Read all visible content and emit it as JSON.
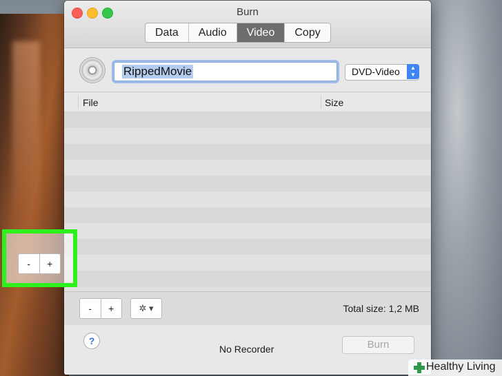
{
  "window": {
    "title": "Burn"
  },
  "tabs": [
    {
      "label": "Data",
      "active": false
    },
    {
      "label": "Audio",
      "active": false
    },
    {
      "label": "Video",
      "active": true
    },
    {
      "label": "Copy",
      "active": false
    }
  ],
  "name_field": {
    "value": "RippedMovie"
  },
  "format_select": {
    "selected": "DVD-Video",
    "icon": "up-down-chevron-icon"
  },
  "table": {
    "columns": [
      "File",
      "Size"
    ],
    "rows": []
  },
  "toolbar": {
    "remove_label": "-",
    "add_label": "+",
    "gear_label": "✲ ▾",
    "total_size": "Total size: 1,2 MB"
  },
  "footer": {
    "help_label": "?",
    "recorder_status": "No Recorder",
    "burn_label": "Burn"
  },
  "watermark": {
    "text": "Healthy Living"
  },
  "colors": {
    "highlight": "#2df01d",
    "select_accent": "#3f86f2",
    "active_tab": "#6d6d6d"
  }
}
